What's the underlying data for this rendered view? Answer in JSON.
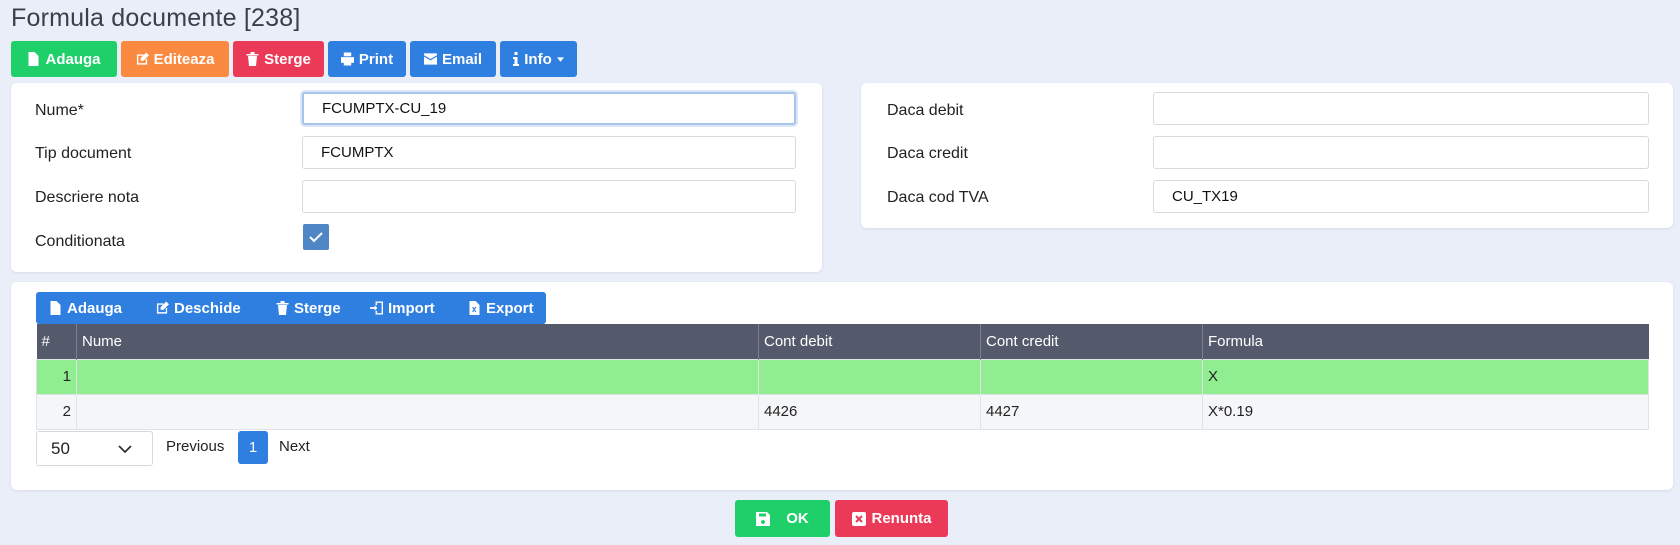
{
  "page": {
    "title": "Formula documente [238]"
  },
  "toolbar": {
    "add": "Adauga",
    "edit": "Editeaza",
    "delete": "Sterge",
    "print": "Print",
    "email": "Email",
    "info": "Info"
  },
  "form_left": {
    "name_label": "Nume*",
    "name_value": "FCUMPTX-CU_19",
    "doc_type_label": "Tip document",
    "doc_type_value": "FCUMPTX",
    "note_label": "Descriere nota",
    "note_value": "",
    "conditional_label": "Conditionata",
    "conditional_checked": true
  },
  "form_right": {
    "debit_label": "Daca debit",
    "debit_value": "",
    "credit_label": "Daca credit",
    "credit_value": "",
    "vat_label": "Daca cod TVA",
    "vat_value": "CU_TX19"
  },
  "grid_toolbar": {
    "add": "Adauga",
    "open": "Deschide",
    "delete": "Sterge",
    "import": "Import",
    "export": "Export"
  },
  "table": {
    "columns": [
      "#",
      "Nume",
      "Cont debit",
      "Cont credit",
      "Formula"
    ],
    "rows": [
      {
        "num": "1",
        "name": "",
        "debit": "",
        "credit": "",
        "formula": "X"
      },
      {
        "num": "2",
        "name": "",
        "debit": "4426",
        "credit": "4427",
        "formula": "X*0.19"
      }
    ]
  },
  "pager": {
    "page_size": "50",
    "previous": "Previous",
    "current": "1",
    "next": "Next"
  },
  "footer": {
    "ok": "OK",
    "cancel": "Renunta"
  },
  "colors": {
    "green": "#1fcf6a",
    "orange": "#f98a40",
    "red": "#ea3a57",
    "blue": "#2f7fe0",
    "selected_row": "#90ee90",
    "header": "#545a6b"
  }
}
